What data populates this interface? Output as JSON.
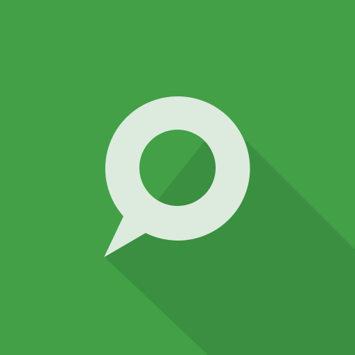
{
  "icon": {
    "name": "chat-bubble-ring-icon",
    "colors": {
      "background": "#43A047",
      "long_shadow": "#3A8F40",
      "bubble": "#DCEBDE",
      "hole": "#43A047"
    }
  }
}
